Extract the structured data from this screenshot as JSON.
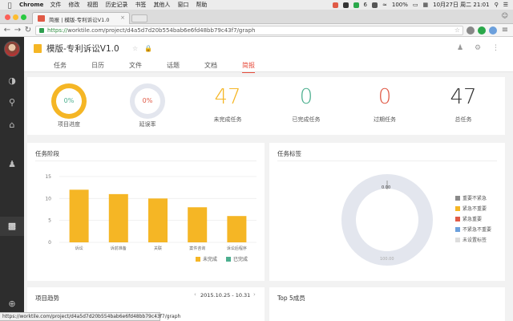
{
  "menubar": {
    "app": "Chrome",
    "items": [
      "文件",
      "修改",
      "视图",
      "历史记录",
      "书签",
      "其他人",
      "窗口",
      "帮助"
    ],
    "battery": "100%",
    "datetime": "10月27日 周二  21:01",
    "badge": "6"
  },
  "browser": {
    "tab_title": "简报 | 模版-专利诉讼V1.0",
    "url_scheme": "https://",
    "url_rest": "worktile.com/project/d4a5d7d20b554bab6e6fd48bb79c43f7/graph",
    "status_url": "https://worktile.com/project/d4a5d7d20b554bab6e6fd48bb79c43f7/graph"
  },
  "header": {
    "title": "模版-专利诉讼V1.0",
    "tabs": [
      "任务",
      "日历",
      "文件",
      "话题",
      "文档",
      "简报"
    ],
    "active_tab": "简报"
  },
  "stats": {
    "progress": {
      "value": "0%",
      "label": "项目进度"
    },
    "delay": {
      "value": "0%",
      "label": "延误率"
    },
    "unfinished": {
      "value": "47",
      "label": "未完成任务",
      "color": "#f5b625"
    },
    "finished": {
      "value": "0",
      "label": "已完成任务",
      "color": "#4caf8f"
    },
    "overdue": {
      "value": "0",
      "label": "过期任务",
      "color": "#e05a46"
    },
    "total": {
      "value": "47",
      "label": "总任务",
      "color": "#333333"
    }
  },
  "stage_panel": {
    "title": "任务阶段"
  },
  "tags_panel": {
    "title": "任务标签",
    "legend": [
      {
        "label": "重要不紧急",
        "color": "#8a8a8a"
      },
      {
        "label": "紧急不重要",
        "color": "#f5b625"
      },
      {
        "label": "紧急重要",
        "color": "#e05a46"
      },
      {
        "label": "不紧急不重要",
        "color": "#6ca0dc"
      },
      {
        "label": "未设置标签",
        "color": "#dddddd"
      }
    ],
    "top_label": "0.00",
    "bottom_label": "100.00"
  },
  "trend_panel": {
    "title": "项目趋势",
    "range": "2015.10.25 - 10.31"
  },
  "top5_panel": {
    "title": "Top 5成员"
  },
  "chart_data": {
    "type": "bar",
    "categories": [
      "诉讼",
      "诉前准备",
      "关联",
      "案件咨询",
      "诉讼后程序"
    ],
    "series": [
      {
        "name": "未完成",
        "values": [
          12,
          11,
          10,
          8,
          6
        ],
        "color": "#f5b625"
      },
      {
        "name": "已完成",
        "values": [
          0,
          0,
          0,
          0,
          0
        ],
        "color": "#4caf8f"
      }
    ],
    "yticks": [
      "15",
      "10",
      "5",
      "0"
    ],
    "ylim": [
      0,
      15
    ],
    "grid": true,
    "legend": "bottom-right"
  }
}
